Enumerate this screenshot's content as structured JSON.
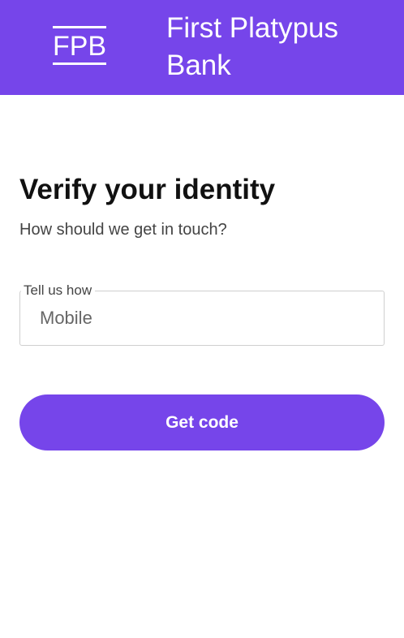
{
  "header": {
    "logo_text": "FPB",
    "bank_name": "First Platypus Bank",
    "background_color": "#7645ea"
  },
  "main": {
    "title": "Verify your identity",
    "subtitle": "How should we get in touch?",
    "contact_field": {
      "label": "Tell us how",
      "value": "Mobile"
    },
    "submit_label": "Get code",
    "accent_color": "#7645ea"
  }
}
